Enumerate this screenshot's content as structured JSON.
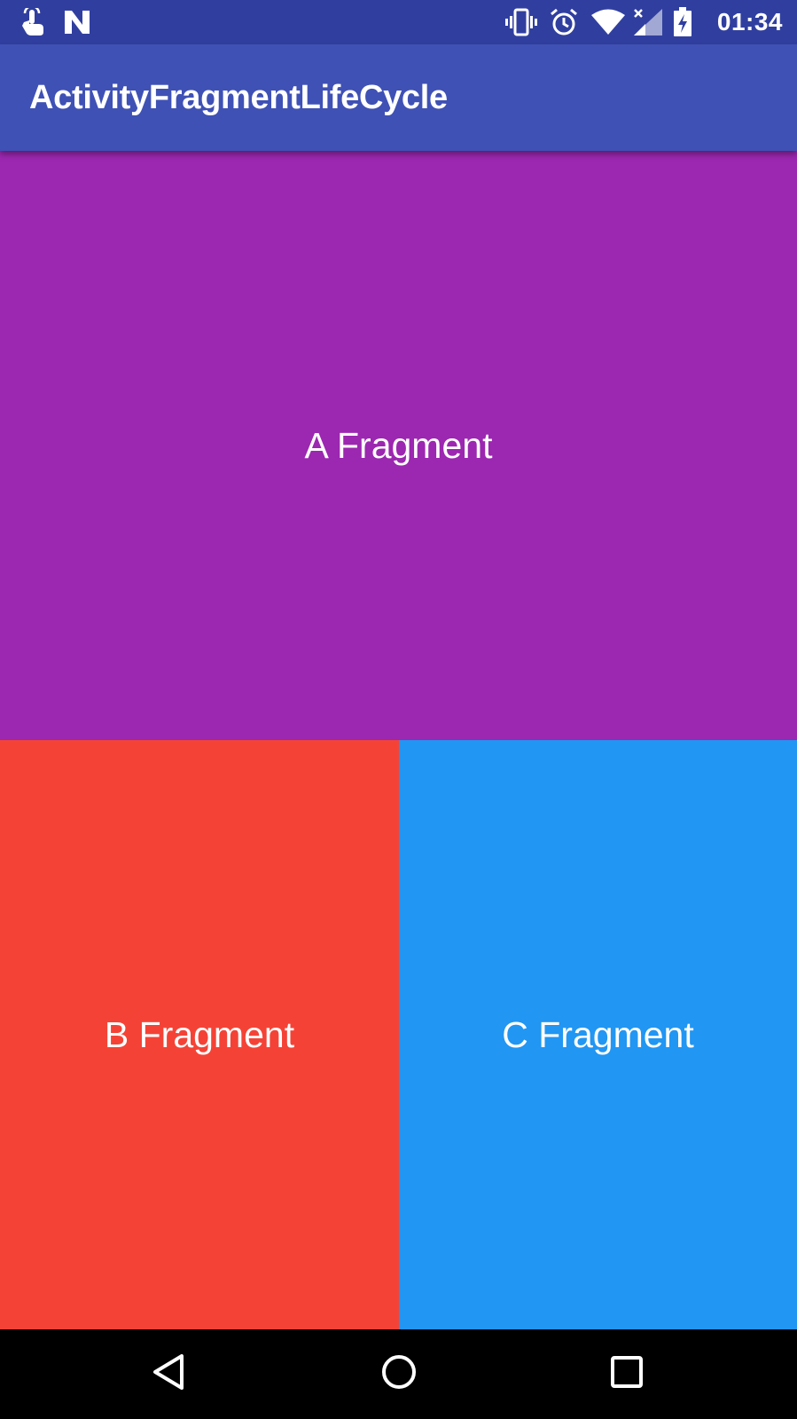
{
  "status_bar": {
    "time": "01:34",
    "left_icons": [
      "touch-gesture-icon",
      "n-notification-icon"
    ],
    "right_icons": [
      "vibrate-icon",
      "alarm-icon",
      "wifi-icon",
      "cellular-no-signal-icon",
      "battery-charging-icon"
    ]
  },
  "app_bar": {
    "title": "ActivityFragmentLifeCycle"
  },
  "fragments": {
    "a": {
      "label": "A Fragment",
      "color": "#9C27B0"
    },
    "b": {
      "label": "B Fragment",
      "color": "#F44336"
    },
    "c": {
      "label": "C Fragment",
      "color": "#2196F3"
    }
  },
  "nav_bar": {
    "buttons": [
      "back-icon",
      "home-icon",
      "recents-icon"
    ]
  },
  "colors": {
    "status_bar": "#303F9F",
    "primary": "#3F51B5"
  }
}
